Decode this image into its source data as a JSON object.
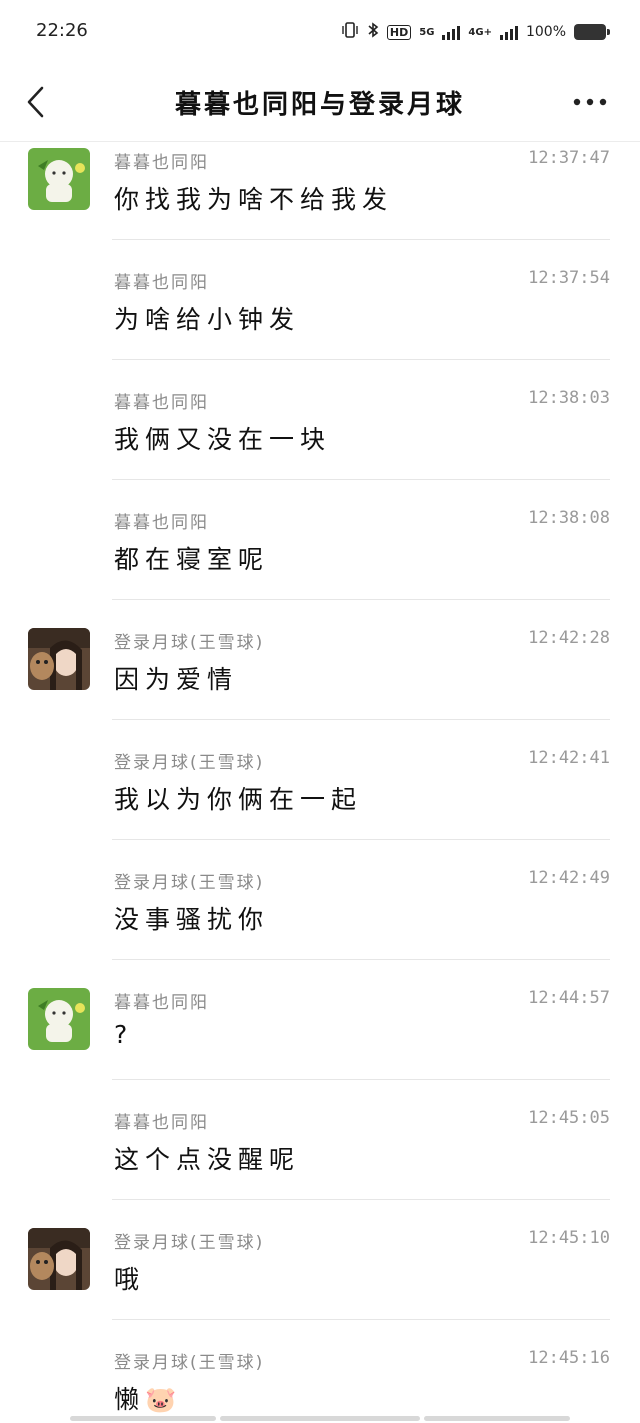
{
  "status": {
    "time": "22:26",
    "net_5g": "5G",
    "net_4g": "4G+",
    "hd": "HD",
    "battery": "100%"
  },
  "header": {
    "title": "暮暮也同阳与登录月球"
  },
  "colors": {
    "avatar_green": "#5fa63b",
    "avatar_photo": "#6b4f3a"
  },
  "messages": [
    {
      "sender": "暮暮也同阳",
      "time": "12:37:47",
      "text": "你找我为啥不给我发",
      "avatar": "green-cartoon-avatar"
    },
    {
      "sender": "暮暮也同阳",
      "time": "12:37:54",
      "text": "为啥给小钟发",
      "avatar": ""
    },
    {
      "sender": "暮暮也同阳",
      "time": "12:38:03",
      "text": "我俩又没在一块",
      "avatar": ""
    },
    {
      "sender": "暮暮也同阳",
      "time": "12:38:08",
      "text": "都在寝室呢",
      "avatar": ""
    },
    {
      "sender": "登录月球(王雪球)",
      "time": "12:42:28",
      "text": "因为爱情",
      "avatar": "photo-avatar"
    },
    {
      "sender": "登录月球(王雪球)",
      "time": "12:42:41",
      "text": "我以为你俩在一起",
      "avatar": ""
    },
    {
      "sender": "登录月球(王雪球)",
      "time": "12:42:49",
      "text": "没事骚扰你",
      "avatar": ""
    },
    {
      "sender": "暮暮也同阳",
      "time": "12:44:57",
      "text": "?",
      "avatar": "green-cartoon-avatar"
    },
    {
      "sender": "暮暮也同阳",
      "time": "12:45:05",
      "text": "这个点没醒呢",
      "avatar": ""
    },
    {
      "sender": "登录月球(王雪球)",
      "time": "12:45:10",
      "text": "哦",
      "avatar": "photo-avatar"
    },
    {
      "sender": "登录月球(王雪球)",
      "time": "12:45:16",
      "text": "懒🐷",
      "avatar": ""
    }
  ]
}
